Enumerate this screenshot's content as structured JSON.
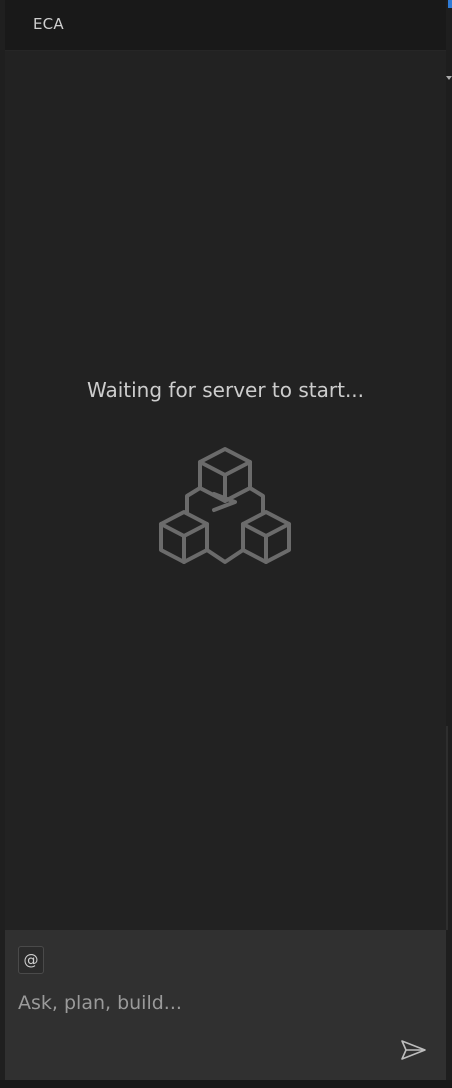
{
  "header": {
    "title": "ECA"
  },
  "main": {
    "status_message": "Waiting for server to start..."
  },
  "composer": {
    "mention_label": "@",
    "placeholder": "Ask, plan, build..."
  },
  "icons": {
    "logo": "eca-cubes-terminal-logo",
    "send": "send-paper-plane-icon",
    "mention": "at-sign-icon"
  },
  "colors": {
    "background": "#222222",
    "header": "#191919",
    "composer": "#303030",
    "text": "#cdcdcd",
    "logo_stroke": "#6b6b6b",
    "accent": "#2f7bd6"
  }
}
